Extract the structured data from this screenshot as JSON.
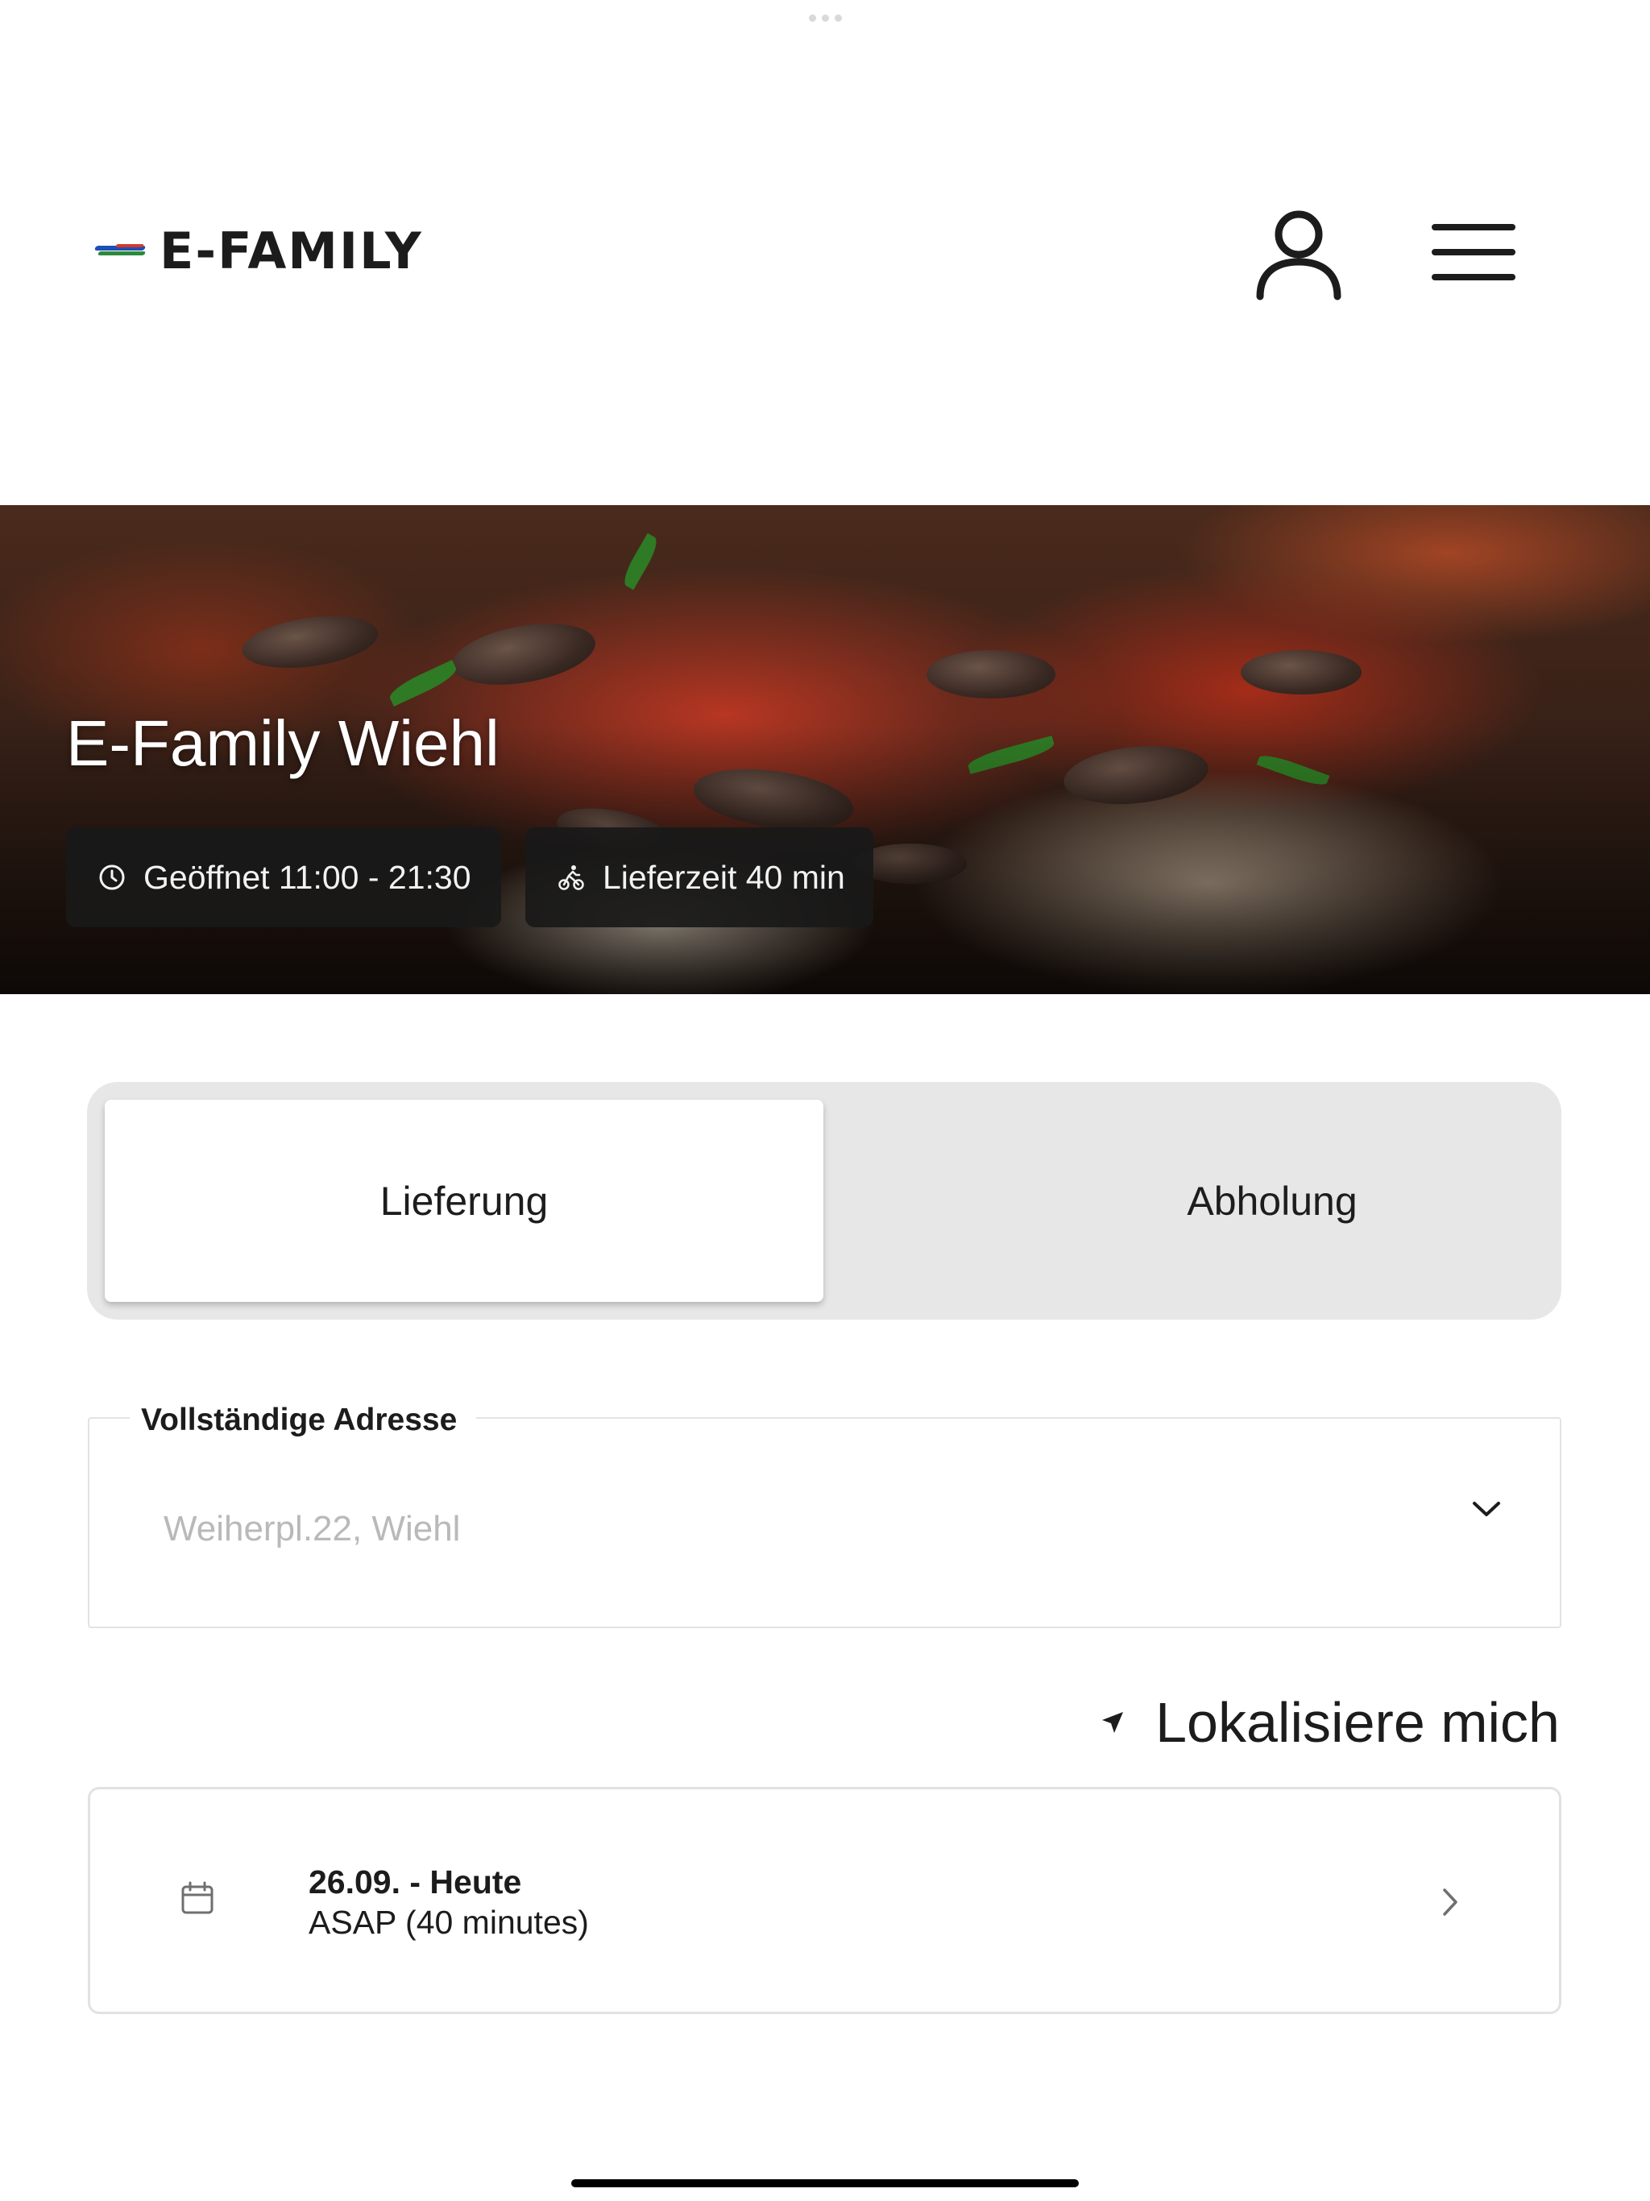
{
  "brand": {
    "logo_text": "E-FAMILY",
    "logo_colors": [
      "#1d4fb8",
      "#2c8a3a",
      "#d63a2a"
    ]
  },
  "header": {
    "icons": [
      "user-icon",
      "hamburger-menu-icon"
    ]
  },
  "hero": {
    "title": "E-Family Wiehl",
    "opening_hours": "Geöffnet 11:00 - 21:30",
    "delivery_time": "Lieferzeit 40 min",
    "chip_icons": [
      "clock-icon",
      "cyclist-icon"
    ]
  },
  "order_mode": {
    "options": [
      "Lieferung",
      "Abholung"
    ],
    "selected": "Lieferung"
  },
  "address": {
    "label": "Vollständige Adresse",
    "placeholder": "Weiherpl.22, Wiehl"
  },
  "locate": {
    "label": "Lokalisiere mich"
  },
  "schedule": {
    "date": "26.09. - Heute",
    "time": "ASAP (40 minutes)"
  }
}
